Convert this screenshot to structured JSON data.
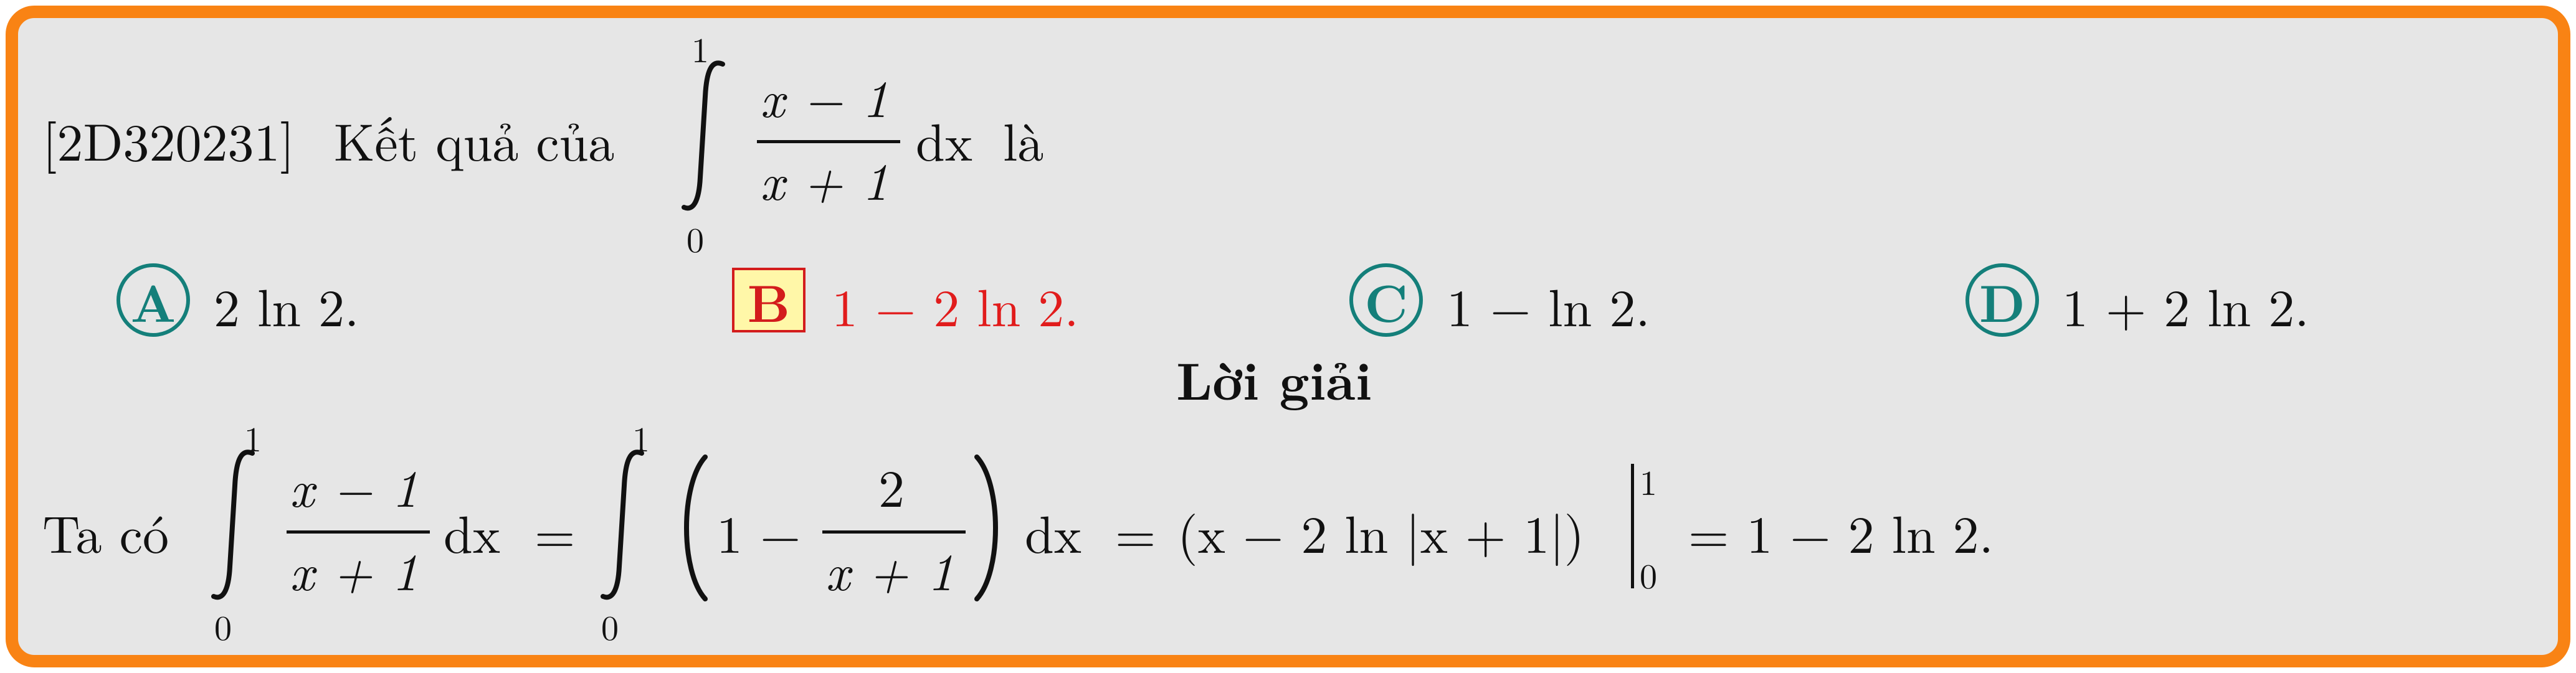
{
  "question": {
    "id_prefix": "[2D320231]",
    "stem_before": "Kết quả của",
    "integral": {
      "upper": "1",
      "lower": "0",
      "numerator": "x − 1",
      "denominator": "x + 1",
      "differential": "dx"
    },
    "stem_after": "là"
  },
  "choices": [
    {
      "letter": "A",
      "text": "2 ln 2.",
      "correct": false
    },
    {
      "letter": "B",
      "text": "1 − 2 ln 2.",
      "correct": true
    },
    {
      "letter": "C",
      "text": "1 − ln 2.",
      "correct": false
    },
    {
      "letter": "D",
      "text": "1 + 2 ln 2.",
      "correct": false
    }
  ],
  "solution": {
    "heading": "Lời giải",
    "lead": "Ta có",
    "int1": {
      "upper": "1",
      "lower": "0",
      "numerator": "x − 1",
      "denominator": "x + 1",
      "differential": "dx"
    },
    "equals1": "=",
    "int2": {
      "upper": "1",
      "lower": "0",
      "one_minus": "1 −",
      "numerator": "2",
      "denominator": "x + 1",
      "differential": "dx"
    },
    "equals2": "=",
    "antiderivative": "(x − 2 ln |x + 1|)",
    "eval_upper": "1",
    "eval_lower": "0",
    "result": "= 1 − 2 ln 2."
  },
  "colors": {
    "border": "#f98314",
    "background": "#e6e6e6",
    "choice_accent": "#147f7a",
    "correct_text": "#e11c1c",
    "correct_box": "#fff7a8"
  }
}
